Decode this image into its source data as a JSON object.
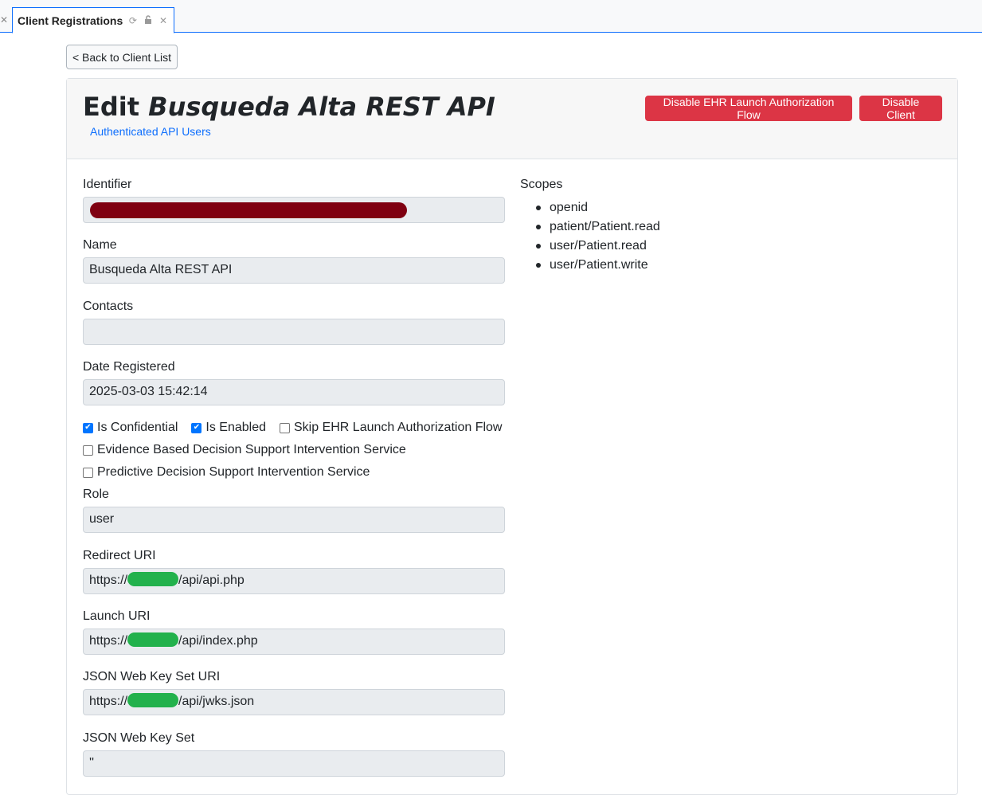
{
  "tab": {
    "title": "Client Registrations"
  },
  "back_button": "< Back to Client List",
  "header": {
    "title_prefix": "Edit ",
    "title_name": "Busqueda Alta REST API",
    "subtitle": "Authenticated API Users",
    "btn_disable_ehr": "Disable EHR Launch Authorization Flow",
    "btn_disable_client": "Disable Client"
  },
  "fields": {
    "identifier_label": "Identifier",
    "name_label": "Name",
    "name_value": "Busqueda Alta REST API",
    "contacts_label": "Contacts",
    "contacts_value": "",
    "date_label": "Date Registered",
    "date_value": "2025-03-03 15:42:14",
    "role_label": "Role",
    "role_value": "user",
    "redirect_label": "Redirect URI",
    "redirect_prefix": "https://",
    "redirect_suffix": "/api/api.php",
    "launch_label": "Launch URI",
    "launch_prefix": "https://",
    "launch_suffix": "/api/index.php",
    "jwks_uri_label": "JSON Web Key Set URI",
    "jwks_uri_prefix": "https://",
    "jwks_uri_suffix": "/api/jwks.json",
    "jwks_label": "JSON Web Key Set",
    "jwks_value": "''"
  },
  "checkboxes": {
    "is_confidential": {
      "label": "Is Confidential",
      "checked": true
    },
    "is_enabled": {
      "label": "Is Enabled",
      "checked": true
    },
    "skip_ehr": {
      "label": "Skip EHR Launch Authorization Flow",
      "checked": false
    },
    "evidence_dsi": {
      "label": "Evidence Based Decision Support Intervention Service",
      "checked": false
    },
    "predictive_dsi": {
      "label": "Predictive Decision Support Intervention Service",
      "checked": false
    }
  },
  "scopes": {
    "label": "Scopes",
    "items": [
      "openid",
      "patient/Patient.read",
      "user/Patient.read",
      "user/Patient.write"
    ]
  },
  "colors": {
    "danger": "#dc3545",
    "link": "#0d6efd",
    "accent": "#0d6efd"
  }
}
